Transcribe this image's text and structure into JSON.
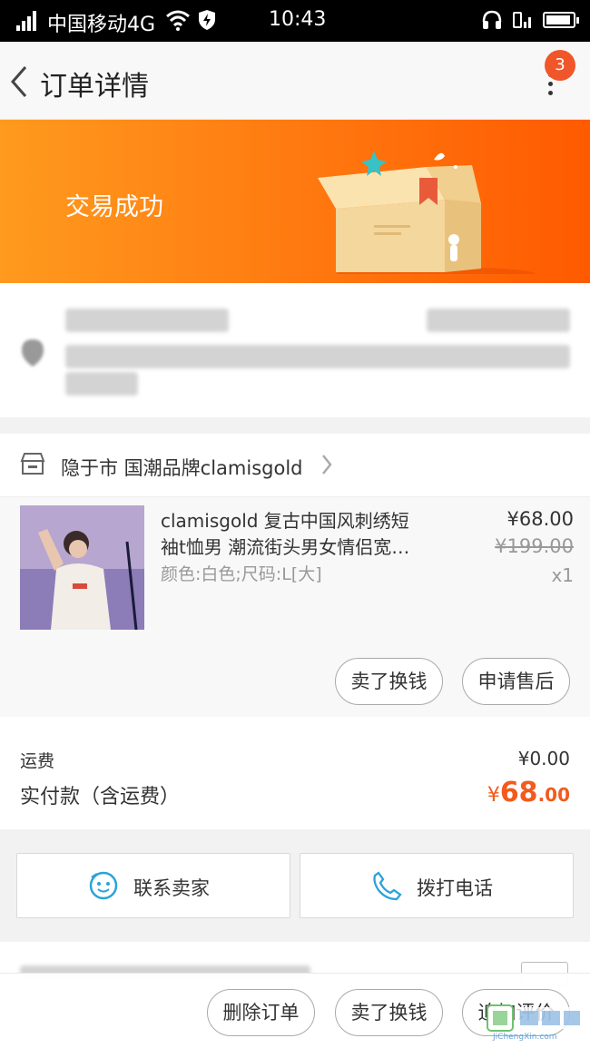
{
  "status_bar": {
    "carrier": "中国移动4G",
    "time": "10:43"
  },
  "nav": {
    "title": "订单详情",
    "badge_count": "3"
  },
  "banner": {
    "status_text": "交易成功"
  },
  "store": {
    "name": "隐于市 国潮品牌clamisgold"
  },
  "item": {
    "title_line1": "clamisgold 复古中国风刺绣短",
    "title_line2": "袖t恤男 潮流街头男女情侣宽…",
    "sku": "颜色:白色;尺码:L[大]",
    "price": "¥68.00",
    "original_price": "¥199.00",
    "quantity": "x1",
    "actions": [
      "卖了换钱",
      "申请售后"
    ]
  },
  "fees": {
    "shipping_label": "运费",
    "shipping_value": "¥0.00",
    "total_label": "实付款（含运费）",
    "total_symbol": "¥",
    "total_int": "68",
    "total_dec": ".00"
  },
  "contact": {
    "seller_label": "联系卖家",
    "phone_label": "拨打电话"
  },
  "bottom_actions": [
    "删除订单",
    "卖了换钱",
    "追加评价"
  ],
  "watermark": {
    "text": "JiChengXin.com"
  },
  "colors": {
    "accent": "#f35a1c",
    "banner_start": "#ff9a1e",
    "banner_end": "#ff5a00",
    "link_blue": "#2aa3d8"
  }
}
